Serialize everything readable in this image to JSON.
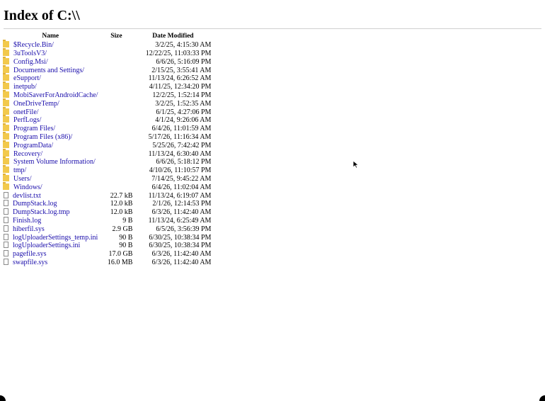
{
  "page": {
    "title": "Index of C:\\\\"
  },
  "table": {
    "headers": {
      "name": "Name",
      "size": "Size",
      "date": "Date Modified"
    },
    "rows": [
      {
        "type": "folder",
        "name": "$Recycle.Bin/",
        "size": "",
        "date": "3/2/25, 4:15:30 AM"
      },
      {
        "type": "folder",
        "name": "3uToolsV3/",
        "size": "",
        "date": "12/22/25, 11:03:33 PM"
      },
      {
        "type": "folder",
        "name": "Config.Msi/",
        "size": "",
        "date": "6/6/26, 5:16:09 PM"
      },
      {
        "type": "folder",
        "name": "Documents and Settings/",
        "size": "",
        "date": "2/15/25, 3:55:41 AM"
      },
      {
        "type": "folder",
        "name": "eSupport/",
        "size": "",
        "date": "11/13/24, 6:26:52 AM"
      },
      {
        "type": "folder",
        "name": "inetpub/",
        "size": "",
        "date": "4/11/25, 12:34:20 PM"
      },
      {
        "type": "folder",
        "name": "MobiSaverForAndroidCache/",
        "size": "",
        "date": "12/2/25, 1:52:14 PM"
      },
      {
        "type": "folder",
        "name": "OneDriveTemp/",
        "size": "",
        "date": "3/2/25, 1:52:35 AM"
      },
      {
        "type": "folder",
        "name": "onetFile/",
        "size": "",
        "date": "6/1/25, 4:27:06 PM"
      },
      {
        "type": "folder",
        "name": "PerfLogs/",
        "size": "",
        "date": "4/1/24, 9:26:06 AM"
      },
      {
        "type": "folder",
        "name": "Program Files/",
        "size": "",
        "date": "6/4/26, 11:01:59 AM"
      },
      {
        "type": "folder",
        "name": "Program Files (x86)/",
        "size": "",
        "date": "5/17/26, 11:16:34 AM"
      },
      {
        "type": "folder",
        "name": "ProgramData/",
        "size": "",
        "date": "5/25/26, 7:42:42 PM"
      },
      {
        "type": "folder",
        "name": "Recovery/",
        "size": "",
        "date": "11/13/24, 6:30:40 AM"
      },
      {
        "type": "folder",
        "name": "System Volume Information/",
        "size": "",
        "date": "6/6/26, 5:18:12 PM"
      },
      {
        "type": "folder",
        "name": "tmp/",
        "size": "",
        "date": "4/10/26, 11:10:57 PM"
      },
      {
        "type": "folder",
        "name": "Users/",
        "size": "",
        "date": "7/14/25, 9:45:22 AM"
      },
      {
        "type": "folder",
        "name": "Windows/",
        "size": "",
        "date": "6/4/26, 11:02:04 AM"
      },
      {
        "type": "file",
        "name": "devlist.txt",
        "size": "22.7 kB",
        "date": "11/13/24, 6:19:07 AM"
      },
      {
        "type": "file",
        "name": "DumpStack.log",
        "size": "12.0 kB",
        "date": "2/1/26, 12:14:53 PM"
      },
      {
        "type": "file",
        "name": "DumpStack.log.tmp",
        "size": "12.0 kB",
        "date": "6/3/26, 11:42:40 AM"
      },
      {
        "type": "file",
        "name": "Finish.log",
        "size": "9 B",
        "date": "11/13/24, 6:25:49 AM"
      },
      {
        "type": "file",
        "name": "hiberfil.sys",
        "size": "2.9 GB",
        "date": "6/5/26, 3:56:39 PM"
      },
      {
        "type": "file",
        "name": "logUploaderSettings_temp.ini",
        "size": "90 B",
        "date": "6/30/25, 10:38:34 PM"
      },
      {
        "type": "file",
        "name": "logUploaderSettings.ini",
        "size": "90 B",
        "date": "6/30/25, 10:38:34 PM"
      },
      {
        "type": "file",
        "name": "pagefile.sys",
        "size": "17.0 GB",
        "date": "6/3/26, 11:42:40 AM"
      },
      {
        "type": "file",
        "name": "swapfile.sys",
        "size": "16.0 MB",
        "date": "6/3/26, 11:42:40 AM"
      }
    ]
  },
  "colors": {
    "link": "#1a0dab",
    "folder_icon": "#f2c94c",
    "rule": "#d0d0d0"
  },
  "icons": {
    "folder": "folder-icon",
    "file": "file-icon",
    "cursor": "mouse-pointer-icon"
  }
}
